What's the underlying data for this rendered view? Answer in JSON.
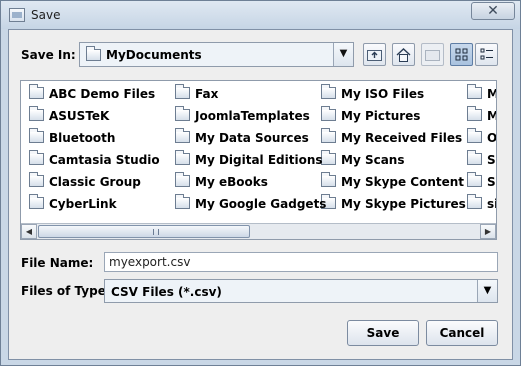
{
  "window": {
    "title": "Save",
    "close_glyph": "✕"
  },
  "save_in": {
    "label": "Save In:",
    "value": "MyDocuments",
    "icon": "folder-icon",
    "arrow": "▼"
  },
  "toolbar": {
    "up_folder": "up-folder-icon",
    "home": "home-icon",
    "new_folder": "new-folder-icon",
    "list_view": "list-view-icon",
    "details_view": "details-view-icon"
  },
  "files": {
    "columns": [
      [
        "ABC Demo Files",
        "ASUSTeK",
        "Bluetooth",
        "Camtasia Studio",
        "Classic Group",
        "CyberLink"
      ],
      [
        "Fax",
        "JoomlaTemplates",
        "My Data Sources",
        "My Digital Editions",
        "My eBooks",
        "My Google Gadgets"
      ],
      [
        "My ISO Files",
        "My Pictures",
        "My Received Files",
        "My Scans",
        "My Skype Content",
        "My Skype Pictures"
      ],
      [
        "My",
        "My",
        "Op",
        "Sc",
        "SD",
        "sig"
      ]
    ]
  },
  "scrollbar": {
    "left_arrow": "◀",
    "right_arrow": "▶",
    "position": 0.45
  },
  "file_name": {
    "label": "File Name:",
    "value": "myexport.csv"
  },
  "file_type": {
    "label": "Files of Type:",
    "value": "CSV Files (*.csv)",
    "arrow": "▼"
  },
  "buttons": {
    "save": "Save",
    "cancel": "Cancel"
  },
  "colors": {
    "titlebar": "#c6d5e5",
    "client": "#eeeeee",
    "accent": "#a9c2df"
  }
}
